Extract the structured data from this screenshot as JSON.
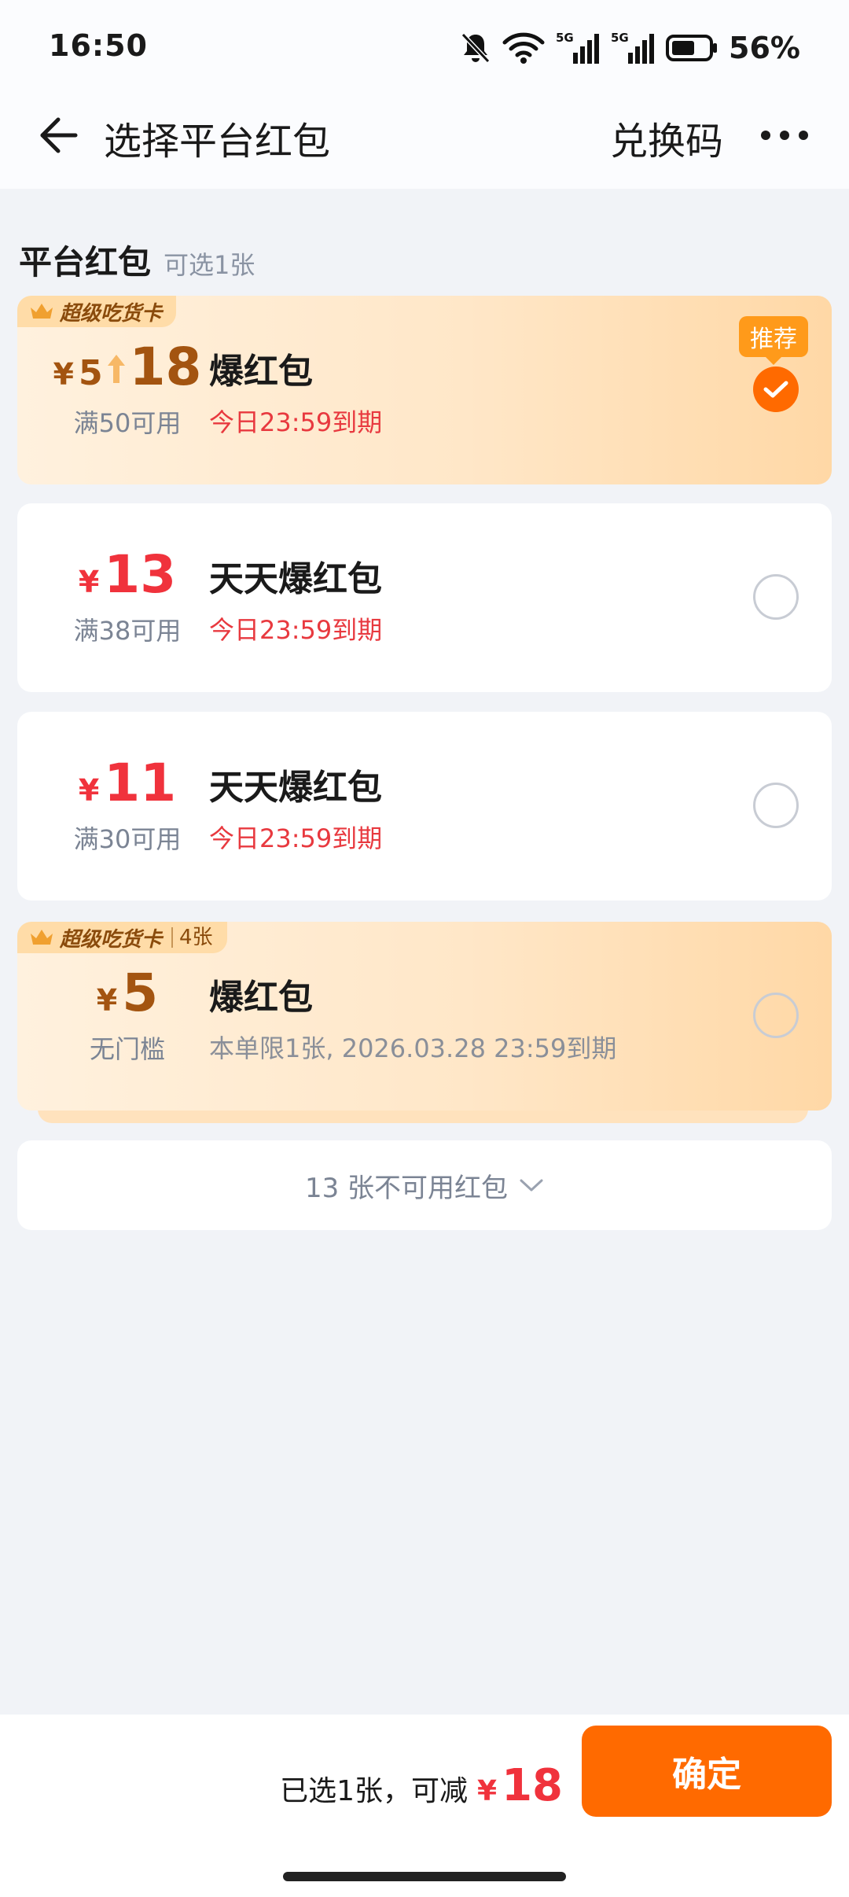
{
  "status_bar": {
    "time": "16:50",
    "battery": "56%",
    "network1": "5G",
    "network2": "5G"
  },
  "header": {
    "title": "选择平台红包",
    "redeem": "兑换码"
  },
  "section": {
    "title": "平台红包",
    "subtitle": "可选1张"
  },
  "coupons": [
    {
      "tag": "超级吃货卡",
      "original_amount": "5",
      "amount": "18",
      "condition": "满50可用",
      "name": "爆红包",
      "expiry": "今日23:59到期",
      "badge": "推荐",
      "selected": true
    },
    {
      "amount": "13",
      "condition": "满38可用",
      "name": "天天爆红包",
      "expiry": "今日23:59到期",
      "selected": false
    },
    {
      "amount": "11",
      "condition": "满30可用",
      "name": "天天爆红包",
      "expiry": "今日23:59到期",
      "selected": false
    },
    {
      "tag": "超级吃货卡",
      "tag_count": "4张",
      "amount": "5",
      "condition": "无门槛",
      "name": "爆红包",
      "expiry": "本单限1张, 2026.03.28 23:59到期",
      "selected": false
    }
  ],
  "currency": "¥",
  "unavailable": {
    "label": "13 张不可用红包"
  },
  "footer": {
    "summary": "已选1张，可减",
    "currency": "¥",
    "amount": "18",
    "confirm": "确定"
  },
  "colors": {
    "accent": "#ff6a00",
    "red": "#f0323c",
    "brown": "#a35410"
  }
}
